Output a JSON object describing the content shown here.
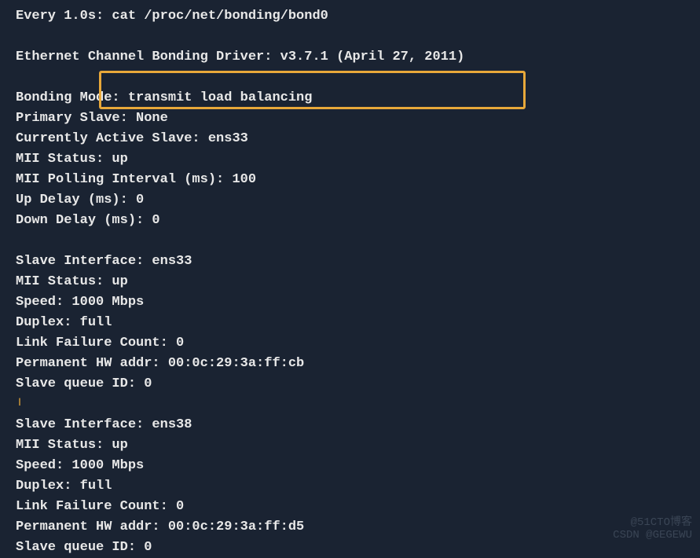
{
  "terminal": {
    "watch_line": "Every 1.0s: cat /proc/net/bonding/bond0",
    "driver_line": "Ethernet Channel Bonding Driver: v3.7.1 (April 27, 2011)",
    "bonding_mode": "Bonding Mode: transmit load balancing",
    "primary_slave": "Primary Slave: None",
    "active_slave": "Currently Active Slave: ens33",
    "mii_status": "MII Status: up",
    "mii_polling": "MII Polling Interval (ms): 100",
    "up_delay": "Up Delay (ms): 0",
    "down_delay": "Down Delay (ms): 0",
    "slave1": {
      "interface": "Slave Interface: ens33",
      "mii_status": "MII Status: up",
      "speed": "Speed: 1000 Mbps",
      "duplex": "Duplex: full",
      "link_failure": "Link Failure Count: 0",
      "hw_addr": "Permanent HW addr: 00:0c:29:3a:ff:cb",
      "queue_id": "Slave queue ID: 0"
    },
    "slave2": {
      "interface": "Slave Interface: ens38",
      "mii_status": "MII Status: up",
      "speed": "Speed: 1000 Mbps",
      "duplex": "Duplex: full",
      "link_failure": "Link Failure Count: 0",
      "hw_addr": "Permanent HW addr: 00:0c:29:3a:ff:d5",
      "queue_id": "Slave queue ID: 0"
    }
  },
  "watermark": {
    "line1": "@51CTO博客",
    "line2": "CSDN @GEGEWU"
  }
}
